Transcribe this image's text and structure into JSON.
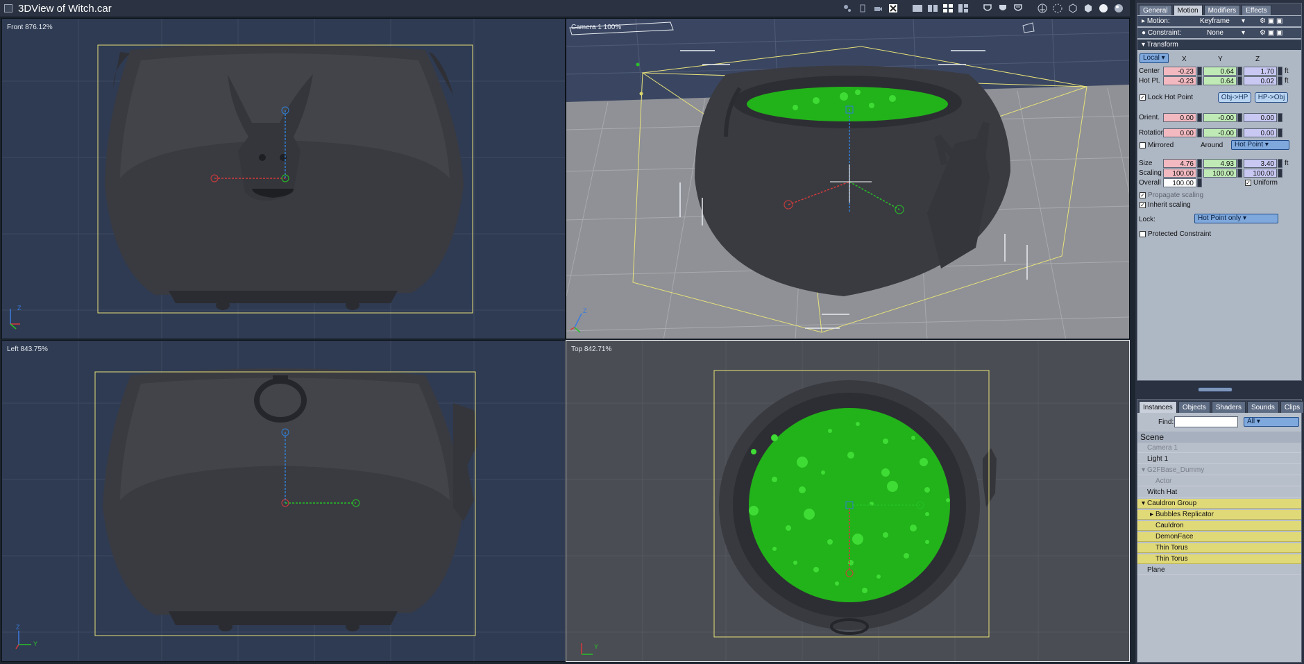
{
  "window": {
    "title": "3DView of Witch.car"
  },
  "viewports": {
    "front": {
      "label": "Front 876.12%"
    },
    "camera": {
      "label": "Camera 1 100%"
    },
    "left": {
      "label": "Left 843.75%"
    },
    "top": {
      "label": "Top 842.71%"
    }
  },
  "axes": {
    "x": "X",
    "y": "Y",
    "z": "Z"
  },
  "props": {
    "tabs": [
      "General",
      "Motion",
      "Modifiers",
      "Effects"
    ],
    "motion": {
      "label": "Motion:",
      "value": "Keyframe"
    },
    "constraint": {
      "label": "Constraint:",
      "value": "None"
    },
    "transform_header": "Transform",
    "coord_mode": "Local",
    "col_x": "X",
    "col_y": "Y",
    "col_z": "Z",
    "center": {
      "label": "Center",
      "x": "-0.23",
      "y": "0.64",
      "z": "1.70",
      "unit": "ft"
    },
    "hotpt": {
      "label": "Hot Pt.",
      "x": "-0.23",
      "y": "0.64",
      "z": "0.02",
      "unit": "ft"
    },
    "lock_hot_point": "Lock Hot Point",
    "obj_hp": "Obj->HP",
    "hp_obj": "HP->Obj",
    "orient": {
      "label": "Orient.",
      "x": "0.00",
      "y": "-0.00",
      "z": "0.00"
    },
    "rotation": {
      "label": "Rotation",
      "x": "0.00",
      "y": "-0.00",
      "z": "0.00"
    },
    "mirrored": "Mirrored",
    "around": "Around",
    "around_value": "Hot Point",
    "size": {
      "label": "Size",
      "x": "4.76",
      "y": "4.93",
      "z": "3.40",
      "unit": "ft"
    },
    "scaling": {
      "label": "Scaling",
      "x": "100.00",
      "y": "100.00",
      "z": "100.00"
    },
    "overall": {
      "label": "Overall",
      "value": "100.00"
    },
    "uniform": "Uniform",
    "propagate_scaling": "Propagate scaling",
    "inherit_scaling": "Inherit scaling",
    "lock": {
      "label": "Lock:",
      "value": "Hot Point only"
    },
    "protected_constraint": "Protected Constraint"
  },
  "scene_panel": {
    "tabs": [
      "Instances",
      "Objects",
      "Shaders",
      "Sounds",
      "Clips"
    ],
    "find_label": "Find:",
    "find_value": "",
    "filter_value": "All",
    "root": "Scene",
    "items": [
      {
        "label": "Camera 1",
        "indent": 1,
        "state": "dim"
      },
      {
        "label": "Light 1",
        "indent": 1,
        "state": "normal"
      },
      {
        "label": "G2FBase_Dummy",
        "indent": 1,
        "state": "dim",
        "toggle": "expanded"
      },
      {
        "label": "Actor",
        "indent": 2,
        "state": "dim"
      },
      {
        "label": "Witch Hat",
        "indent": 1,
        "state": "normal"
      },
      {
        "label": "Cauldron Group",
        "indent": 1,
        "state": "selected",
        "toggle": "expanded"
      },
      {
        "label": "Bubbles Replicator",
        "indent": 2,
        "state": "selected",
        "toggle": "collapsed"
      },
      {
        "label": "Cauldron",
        "indent": 2,
        "state": "selected"
      },
      {
        "label": "DemonFace",
        "indent": 2,
        "state": "selected"
      },
      {
        "label": "Thin Torus",
        "indent": 2,
        "state": "selected"
      },
      {
        "label": "Thin Torus",
        "indent": 2,
        "state": "selected"
      },
      {
        "label": "Plane",
        "indent": 1,
        "state": "normal"
      }
    ]
  },
  "colors": {
    "viewport_blue": "#2f3b52",
    "viewport_gray": "#4a4d53",
    "cauldron": "#3b3c42",
    "liquid": "#22b21a",
    "bounding_box": "#e8e27a",
    "selection": "#e0d978"
  }
}
